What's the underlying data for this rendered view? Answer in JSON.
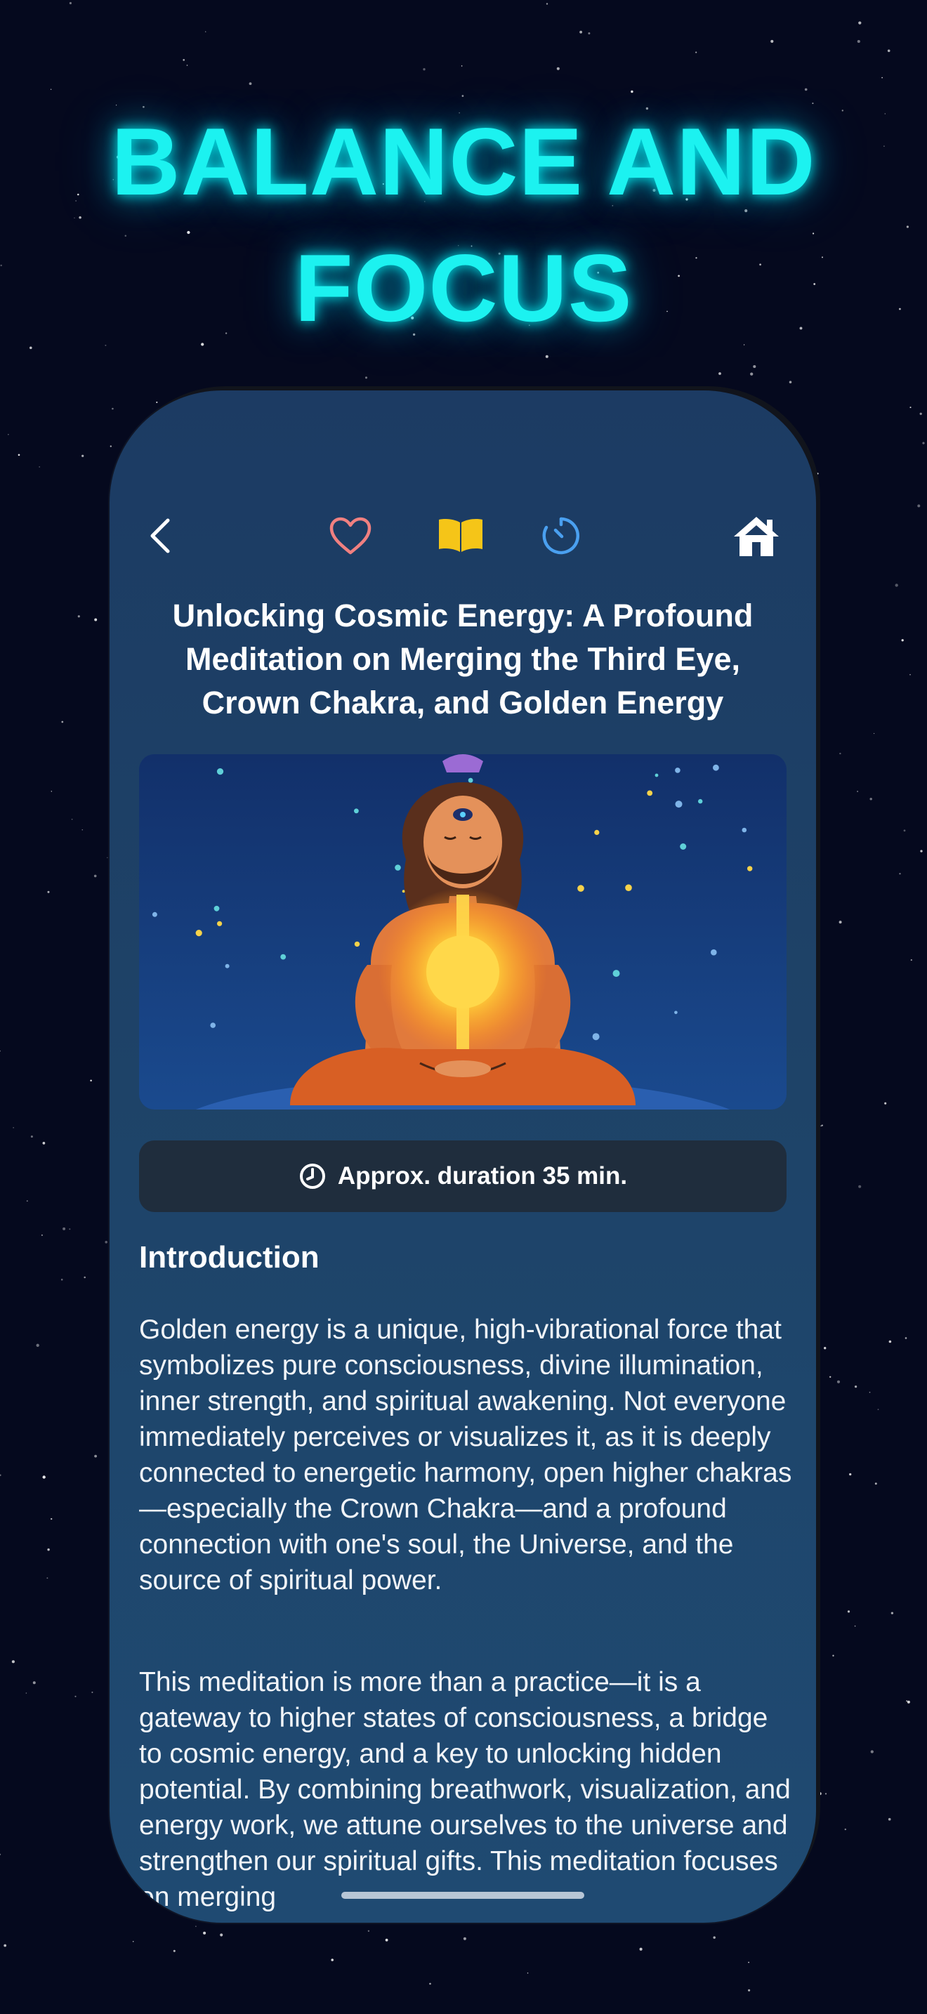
{
  "headline": {
    "line1": "BALANCE AND",
    "line2": "FOCUS",
    "color": "#1cf2f0"
  },
  "nav": {
    "icons": [
      "chevron-left-icon",
      "heart-icon",
      "book-icon",
      "timer-icon",
      "home-icon"
    ],
    "colors": {
      "back": "#ffffff",
      "heart": "#f08080",
      "book": "#f5c518",
      "timer": "#4aa0f0",
      "home": "#ffffff"
    }
  },
  "article": {
    "title": "Unlocking Cosmic Energy: A Profound Meditation on Merging the Third Eye, Crown Chakra, and Golden Energy",
    "image_subject": "meditating figure with glowing golden energy, third eye and crown chakra on starry sky",
    "duration_label": "Approx. duration 35 min.",
    "section_heading": "Introduction",
    "paragraph1": "Golden energy is a unique, high-vibrational force that symbolizes pure consciousness, divine illumination, inner strength, and spiritual awakening. Not everyone immediately perceives or visualizes it, as it is deeply connected to energetic harmony, open higher chakras—especially the Crown Chakra—and a profound connection with one's soul, the Universe, and the source of spiritual power.",
    "paragraph2": "This meditation is more than a practice—it is a gateway to higher states of consciousness, a bridge to cosmic energy, and a key to unlocking hidden potential. By combining breathwork, visualization, and energy work, we attune ourselves to the universe and strengthen our spiritual gifts. This meditation focuses on merging"
  },
  "colors": {
    "background": "#05091e",
    "card": "#1e4368",
    "duration_bar": "#1f2d3d"
  }
}
